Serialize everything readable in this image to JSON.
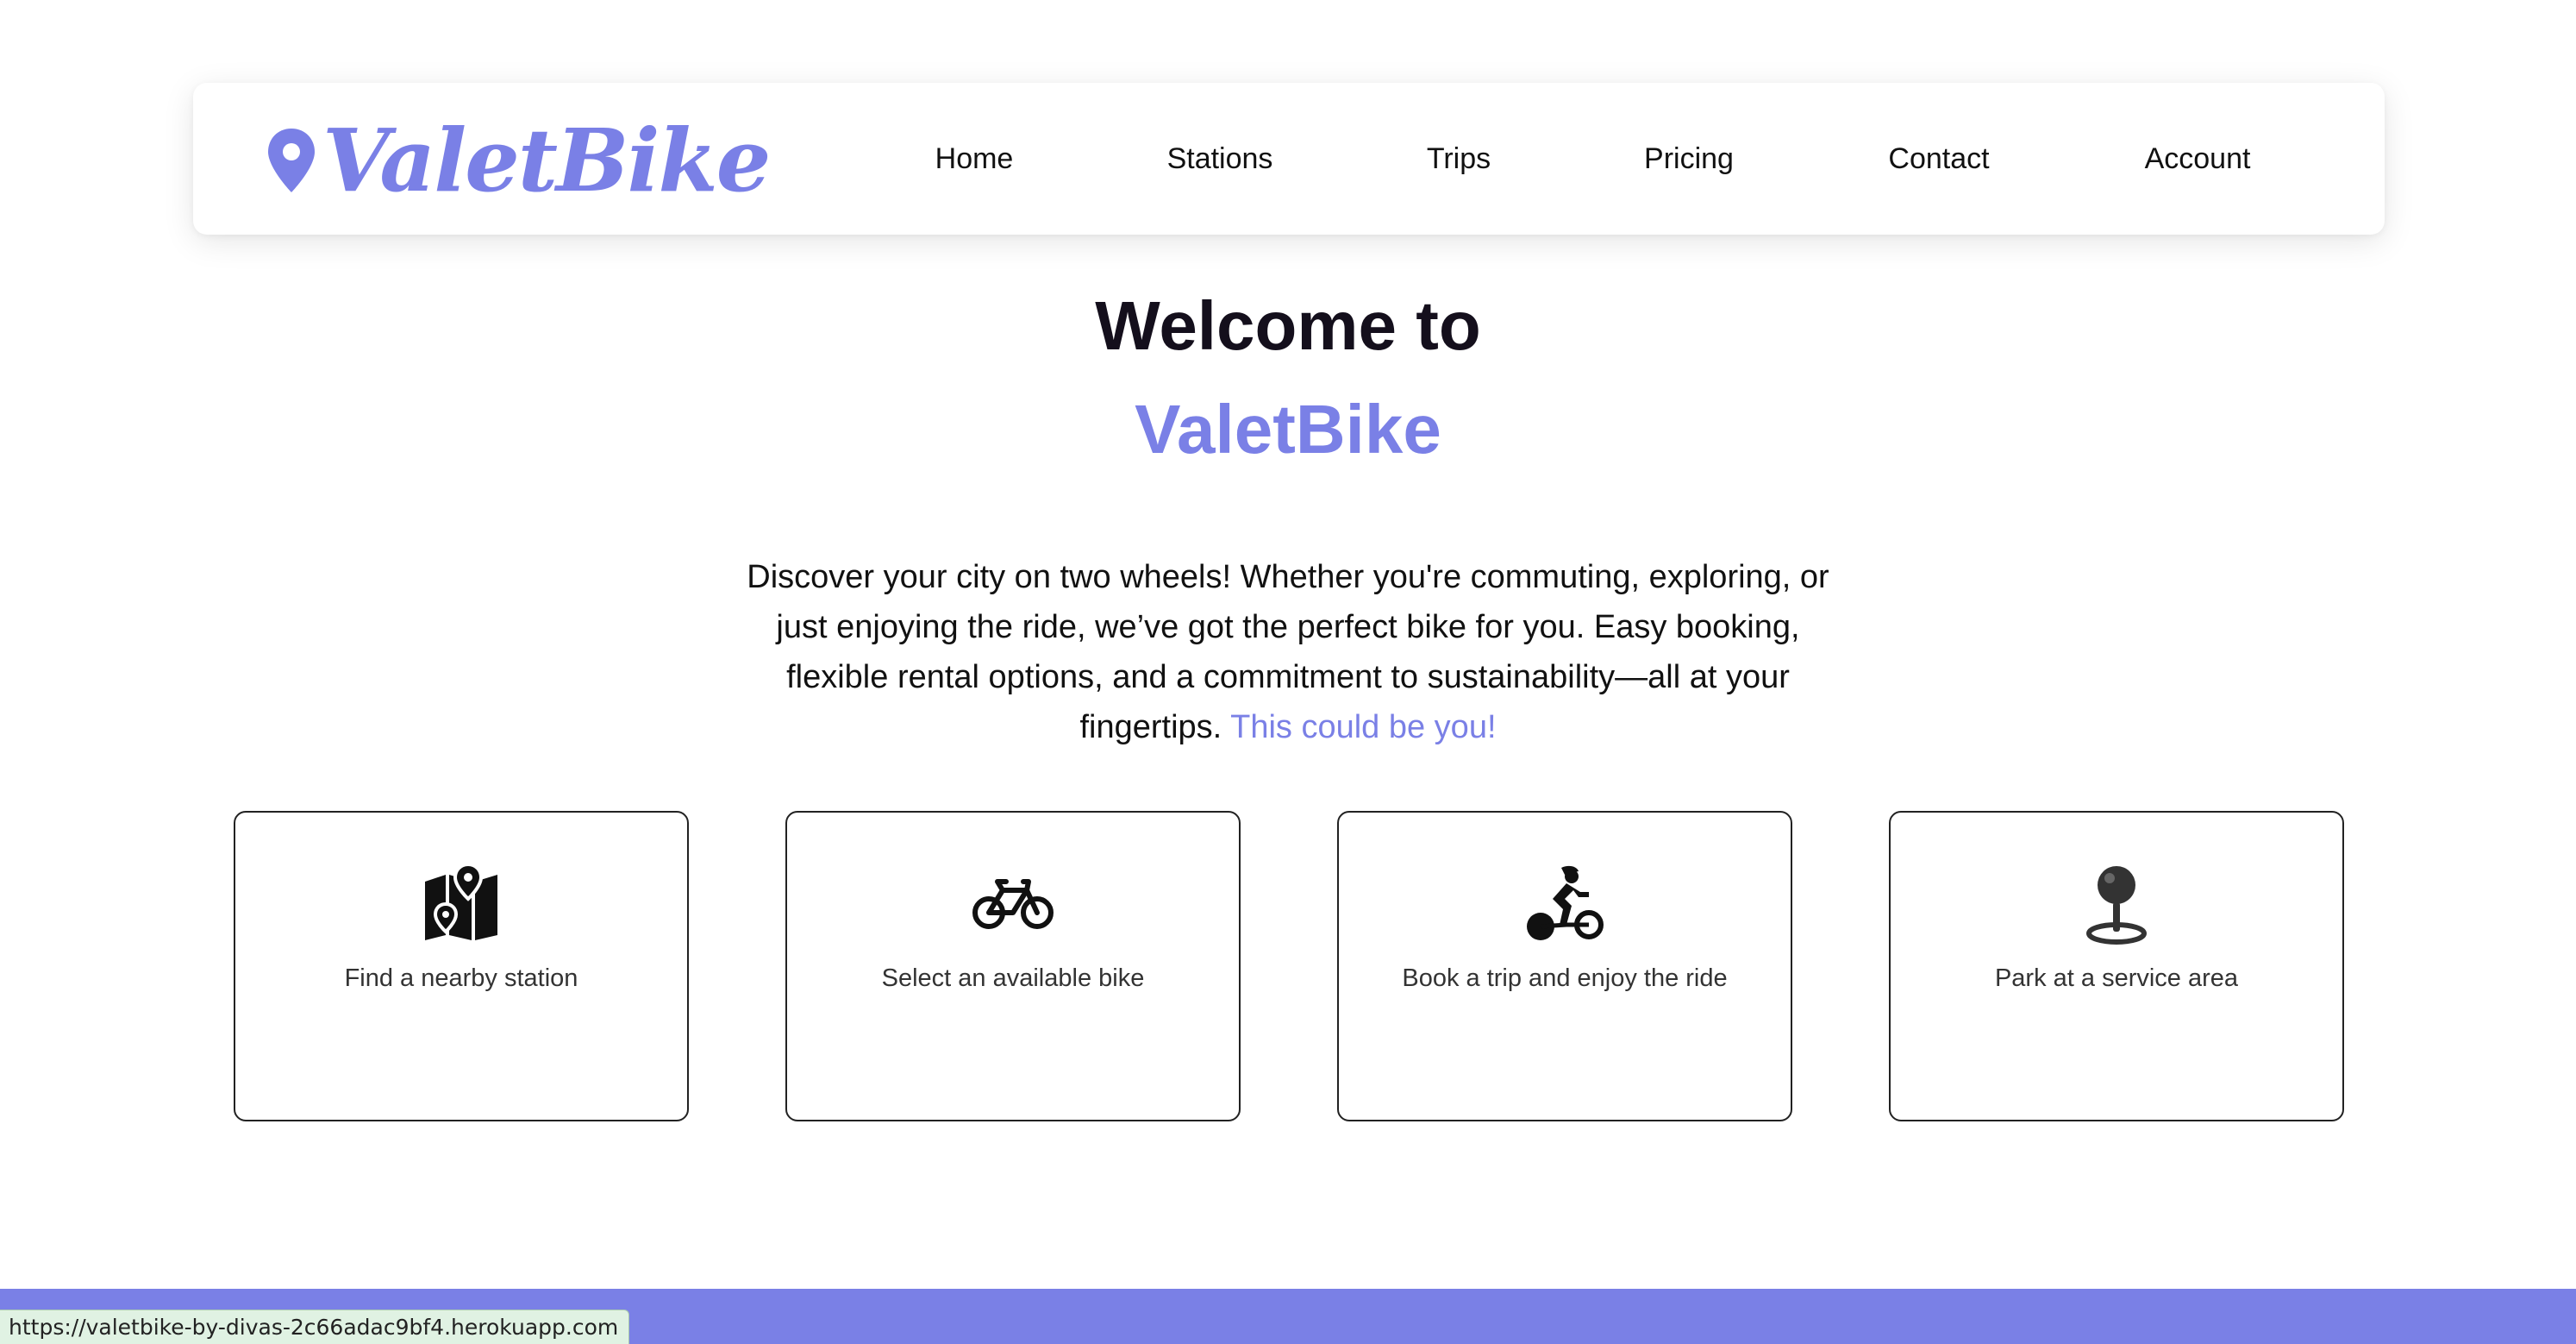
{
  "brand": {
    "name": "ValetBike",
    "color": "#7a80e6"
  },
  "nav": {
    "items": [
      {
        "label": "Home"
      },
      {
        "label": "Stations"
      },
      {
        "label": "Trips"
      },
      {
        "label": "Pricing"
      },
      {
        "label": "Contact"
      },
      {
        "label": "Account"
      }
    ]
  },
  "hero": {
    "line1": "Welcome to",
    "line2": "ValetBike",
    "intro": "Discover your city on two wheels! Whether you're commuting, exploring, or just enjoying the ride, we’ve got the perfect bike for you. Easy booking, flexible rental options, and a commitment to sustainability—all at your fingertips. ",
    "intro_accent": "This could be you!"
  },
  "steps": [
    {
      "icon": "map-pin-icon",
      "label": "Find a nearby station"
    },
    {
      "icon": "bicycle-icon",
      "label": "Select an available bike"
    },
    {
      "icon": "cyclist-icon",
      "label": "Book a trip and enjoy the ride"
    },
    {
      "icon": "pushpin-icon",
      "label": "Park at a service area"
    }
  ],
  "status_bar": {
    "url": "https://valetbike-by-divas-2c66adac9bf4.herokuapp.com"
  },
  "colors": {
    "accent": "#7a80e6",
    "heading": "#140f1c",
    "status_bg": "#e0f2e3"
  }
}
